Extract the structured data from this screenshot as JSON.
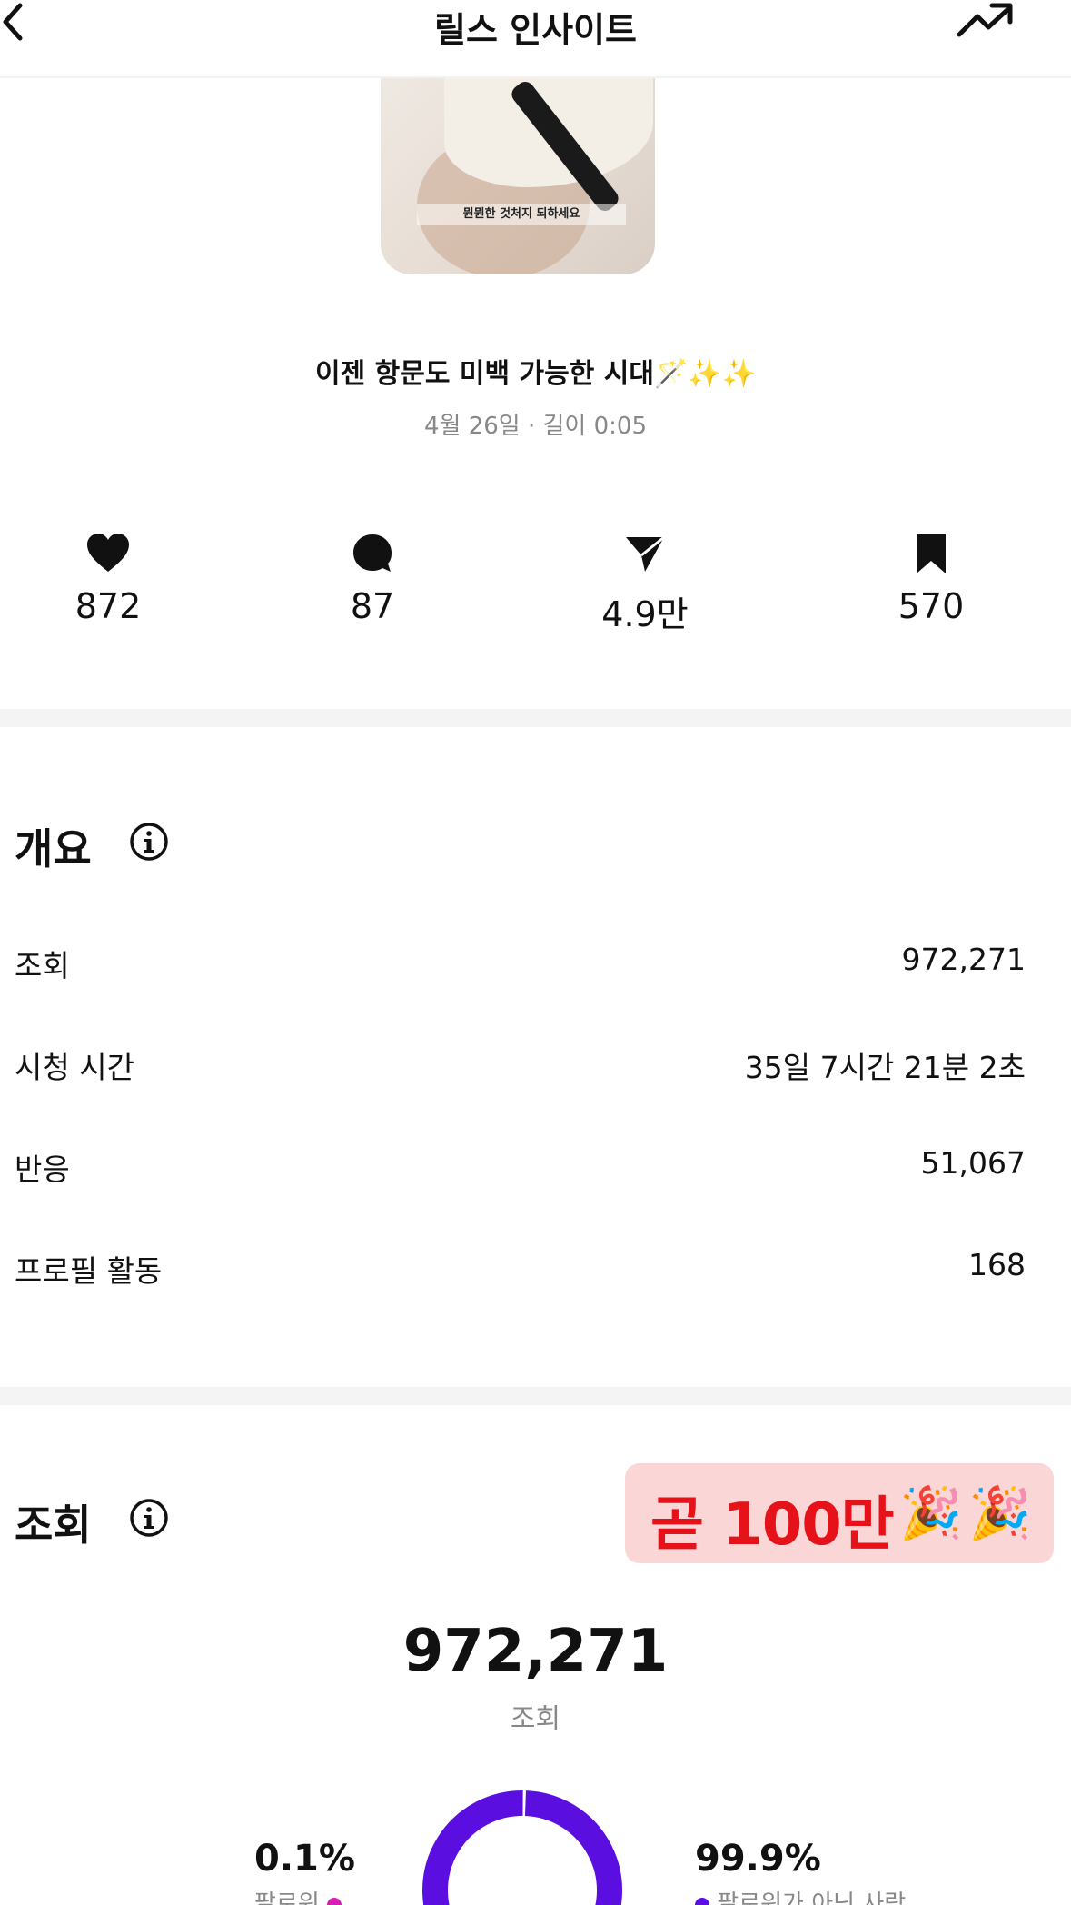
{
  "header": {
    "title": "릴스 인사이트"
  },
  "reel": {
    "thumb_caption": "뭔뭔한 것처지 되하세요",
    "title": "이젠 항문도 미백 가능한 시대🪄✨✨",
    "meta": "4월 26일 · 길이 0:05"
  },
  "stats": [
    {
      "icon": "heart-icon",
      "value": "872"
    },
    {
      "icon": "comment-icon",
      "value": "87"
    },
    {
      "icon": "share-icon",
      "value": "4.9만"
    },
    {
      "icon": "bookmark-icon",
      "value": "570"
    }
  ],
  "overview": {
    "title": "개요",
    "rows": [
      {
        "label": "조회",
        "value": "972,271"
      },
      {
        "label": "시청 시간",
        "value": "35일 7시간 21분 2초"
      },
      {
        "label": "반응",
        "value": "51,067"
      },
      {
        "label": "프로필 활동",
        "value": "168"
      }
    ]
  },
  "views": {
    "title": "조회",
    "sticker": "곧 100만",
    "total": "972,271",
    "total_label": "조회",
    "followers_pct": "0.1%",
    "followers_label": "팔로워",
    "non_followers_pct": "99.9%",
    "non_followers_label": "팔로워가 아닌 사람",
    "followers_fraction": 0.001,
    "non_followers_fraction": 0.999
  },
  "colors": {
    "follower": "#d61fb0",
    "non_follower": "#5a0fe0",
    "sticker_bg": "#fbd6d6",
    "sticker_text": "#e5121a",
    "muted": "#888888"
  }
}
